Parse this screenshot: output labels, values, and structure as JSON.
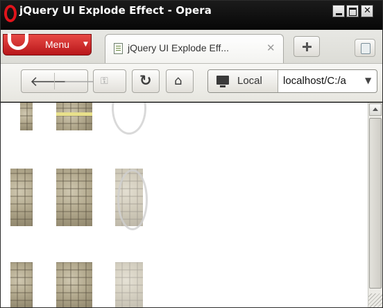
{
  "window": {
    "title": "jQuery UI Explode Effect - Opera"
  },
  "menu": {
    "label": "Menu"
  },
  "tabs": [
    {
      "title": "jQuery UI Explode Eff...",
      "close_glyph": "✕"
    }
  ],
  "toolbar": {
    "security_label": "Local",
    "address_value": "localhost/C:/a",
    "address_dropdown_glyph": "▼"
  },
  "icons": {
    "back": "arrow-left-icon",
    "forward": "arrow-right-icon",
    "key": "key-icon",
    "reload": "reload-icon",
    "home": "home-icon",
    "monitor": "monitor-icon",
    "new_tab": "plus-icon",
    "trash": "trash-icon"
  },
  "colors": {
    "menu_red": "#c91d1f",
    "titlebar": "#0d0d0d"
  }
}
